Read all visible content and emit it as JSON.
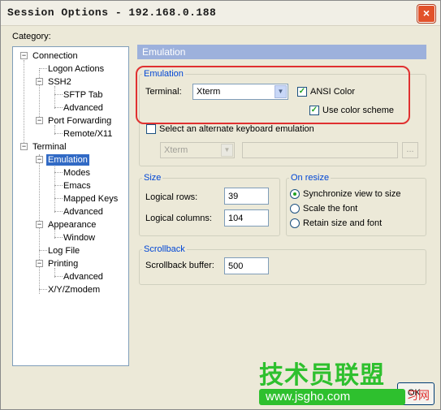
{
  "window": {
    "title": "Session Options - 192.168.0.188",
    "close_glyph": "×"
  },
  "category_label": "Category:",
  "tree": {
    "connection": "Connection",
    "logon_actions": "Logon Actions",
    "ssh2": "SSH2",
    "sftp_tab": "SFTP Tab",
    "ssh2_advanced": "Advanced",
    "port_forwarding": "Port Forwarding",
    "remote_x11": "Remote/X11",
    "terminal": "Terminal",
    "emulation": "Emulation",
    "modes": "Modes",
    "emacs": "Emacs",
    "mapped_keys": "Mapped Keys",
    "emulation_advanced": "Advanced",
    "appearance": "Appearance",
    "window": "Window",
    "log_file": "Log File",
    "printing": "Printing",
    "printing_advanced": "Advanced",
    "xyzmodem": "X/Y/Zmodem",
    "expand_glyph": "−"
  },
  "pane": {
    "header": "Emulation",
    "emulation_group": "Emulation",
    "terminal_label": "Terminal:",
    "terminal_value": "Xterm",
    "ansi_color": "ANSI Color",
    "use_color_scheme": "Use color scheme",
    "alt_keyboard": "Select an alternate keyboard emulation",
    "alt_keyboard_value": "Xterm",
    "browse": "...",
    "size_group": "Size",
    "logical_rows_label": "Logical rows:",
    "logical_rows": "39",
    "logical_columns_label": "Logical columns:",
    "logical_columns": "104",
    "on_resize_group": "On resize",
    "sync_view": "Synchronize view to size",
    "scale_font": "Scale the font",
    "retain_size": "Retain size and font",
    "scrollback_group": "Scrollback",
    "scrollback_label": "Scrollback buffer:",
    "scrollback_buffer": "500"
  },
  "checkmark": "✓",
  "dropdown_arrow": "▼",
  "ok_label": "OK",
  "watermark": {
    "line1": "技术员联盟",
    "line2": "www.jsgho.com",
    "tail": "习网"
  },
  "colors": {
    "selection": "#316ac5",
    "header": "#9db1dc",
    "highlight_box": "#e03030",
    "watermark": "#2ec02e"
  }
}
